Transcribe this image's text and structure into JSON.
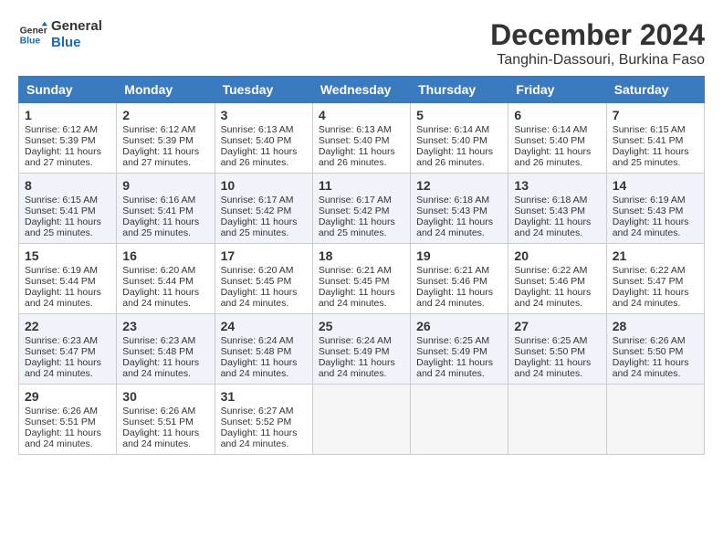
{
  "logo": {
    "line1": "General",
    "line2": "Blue"
  },
  "title": "December 2024",
  "subtitle": "Tanghin-Dassouri, Burkina Faso",
  "days_of_week": [
    "Sunday",
    "Monday",
    "Tuesday",
    "Wednesday",
    "Thursday",
    "Friday",
    "Saturday"
  ],
  "weeks": [
    [
      {
        "day": "1",
        "sunrise": "6:12 AM",
        "sunset": "5:39 PM",
        "daylight": "11 hours and 27 minutes."
      },
      {
        "day": "2",
        "sunrise": "6:12 AM",
        "sunset": "5:39 PM",
        "daylight": "11 hours and 27 minutes."
      },
      {
        "day": "3",
        "sunrise": "6:13 AM",
        "sunset": "5:40 PM",
        "daylight": "11 hours and 26 minutes."
      },
      {
        "day": "4",
        "sunrise": "6:13 AM",
        "sunset": "5:40 PM",
        "daylight": "11 hours and 26 minutes."
      },
      {
        "day": "5",
        "sunrise": "6:14 AM",
        "sunset": "5:40 PM",
        "daylight": "11 hours and 26 minutes."
      },
      {
        "day": "6",
        "sunrise": "6:14 AM",
        "sunset": "5:40 PM",
        "daylight": "11 hours and 26 minutes."
      },
      {
        "day": "7",
        "sunrise": "6:15 AM",
        "sunset": "5:41 PM",
        "daylight": "11 hours and 25 minutes."
      }
    ],
    [
      {
        "day": "8",
        "sunrise": "6:15 AM",
        "sunset": "5:41 PM",
        "daylight": "11 hours and 25 minutes."
      },
      {
        "day": "9",
        "sunrise": "6:16 AM",
        "sunset": "5:41 PM",
        "daylight": "11 hours and 25 minutes."
      },
      {
        "day": "10",
        "sunrise": "6:17 AM",
        "sunset": "5:42 PM",
        "daylight": "11 hours and 25 minutes."
      },
      {
        "day": "11",
        "sunrise": "6:17 AM",
        "sunset": "5:42 PM",
        "daylight": "11 hours and 25 minutes."
      },
      {
        "day": "12",
        "sunrise": "6:18 AM",
        "sunset": "5:43 PM",
        "daylight": "11 hours and 24 minutes."
      },
      {
        "day": "13",
        "sunrise": "6:18 AM",
        "sunset": "5:43 PM",
        "daylight": "11 hours and 24 minutes."
      },
      {
        "day": "14",
        "sunrise": "6:19 AM",
        "sunset": "5:43 PM",
        "daylight": "11 hours and 24 minutes."
      }
    ],
    [
      {
        "day": "15",
        "sunrise": "6:19 AM",
        "sunset": "5:44 PM",
        "daylight": "11 hours and 24 minutes."
      },
      {
        "day": "16",
        "sunrise": "6:20 AM",
        "sunset": "5:44 PM",
        "daylight": "11 hours and 24 minutes."
      },
      {
        "day": "17",
        "sunrise": "6:20 AM",
        "sunset": "5:45 PM",
        "daylight": "11 hours and 24 minutes."
      },
      {
        "day": "18",
        "sunrise": "6:21 AM",
        "sunset": "5:45 PM",
        "daylight": "11 hours and 24 minutes."
      },
      {
        "day": "19",
        "sunrise": "6:21 AM",
        "sunset": "5:46 PM",
        "daylight": "11 hours and 24 minutes."
      },
      {
        "day": "20",
        "sunrise": "6:22 AM",
        "sunset": "5:46 PM",
        "daylight": "11 hours and 24 minutes."
      },
      {
        "day": "21",
        "sunrise": "6:22 AM",
        "sunset": "5:47 PM",
        "daylight": "11 hours and 24 minutes."
      }
    ],
    [
      {
        "day": "22",
        "sunrise": "6:23 AM",
        "sunset": "5:47 PM",
        "daylight": "11 hours and 24 minutes."
      },
      {
        "day": "23",
        "sunrise": "6:23 AM",
        "sunset": "5:48 PM",
        "daylight": "11 hours and 24 minutes."
      },
      {
        "day": "24",
        "sunrise": "6:24 AM",
        "sunset": "5:48 PM",
        "daylight": "11 hours and 24 minutes."
      },
      {
        "day": "25",
        "sunrise": "6:24 AM",
        "sunset": "5:49 PM",
        "daylight": "11 hours and 24 minutes."
      },
      {
        "day": "26",
        "sunrise": "6:25 AM",
        "sunset": "5:49 PM",
        "daylight": "11 hours and 24 minutes."
      },
      {
        "day": "27",
        "sunrise": "6:25 AM",
        "sunset": "5:50 PM",
        "daylight": "11 hours and 24 minutes."
      },
      {
        "day": "28",
        "sunrise": "6:26 AM",
        "sunset": "5:50 PM",
        "daylight": "11 hours and 24 minutes."
      }
    ],
    [
      {
        "day": "29",
        "sunrise": "6:26 AM",
        "sunset": "5:51 PM",
        "daylight": "11 hours and 24 minutes."
      },
      {
        "day": "30",
        "sunrise": "6:26 AM",
        "sunset": "5:51 PM",
        "daylight": "11 hours and 24 minutes."
      },
      {
        "day": "31",
        "sunrise": "6:27 AM",
        "sunset": "5:52 PM",
        "daylight": "11 hours and 24 minutes."
      },
      null,
      null,
      null,
      null
    ]
  ],
  "labels": {
    "sunrise": "Sunrise:",
    "sunset": "Sunset:",
    "daylight": "Daylight:"
  }
}
